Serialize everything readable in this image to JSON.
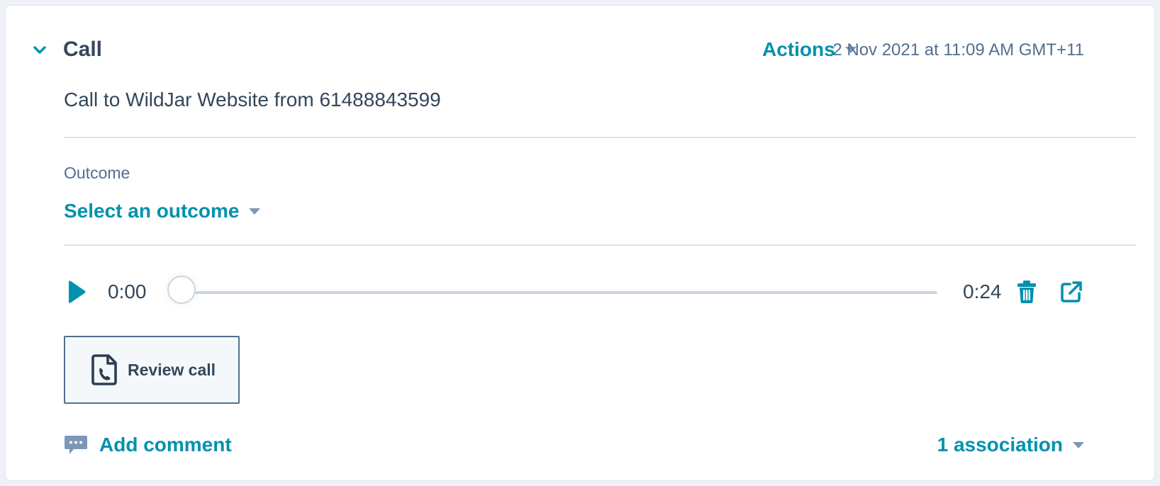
{
  "activity": {
    "type_title": "Call",
    "actions_label": "Actions",
    "timestamp": "2 Nov 2021 at 11:09 AM GMT+11",
    "subject": "Call to WildJar Website from 61488843599"
  },
  "outcome": {
    "label": "Outcome",
    "select_label": "Select an outcome"
  },
  "player": {
    "current_time": "0:00",
    "total_time": "0:24",
    "progress": 0
  },
  "review": {
    "label": "Review call"
  },
  "footer": {
    "add_comment_label": "Add comment",
    "association_label": "1 association"
  },
  "colors": {
    "accent": "#0091ae",
    "text_primary": "#33475b",
    "text_secondary": "#516f90",
    "caret": "#7c98b6",
    "divider": "#dfe3eb",
    "icon_dark": "#2d3e50"
  },
  "icons": {
    "collapse": "chevron-down-icon",
    "play": "play-icon",
    "delete": "trash-icon",
    "external": "external-link-icon",
    "review": "phone-document-icon",
    "comment": "comment-bubble-icon",
    "dropdown": "caret-down-icon"
  }
}
